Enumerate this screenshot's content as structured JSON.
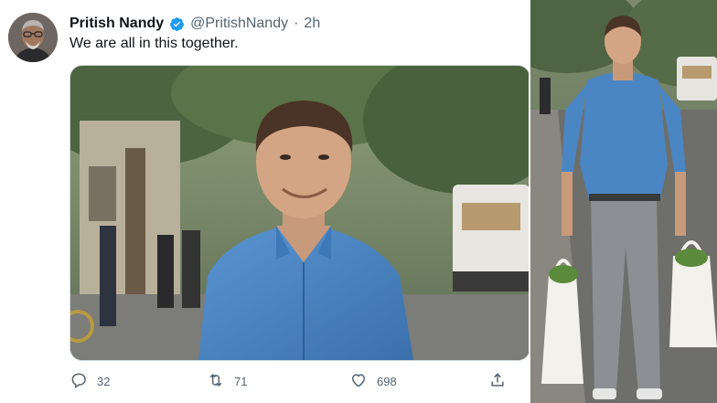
{
  "tweet": {
    "display_name": "Pritish Nandy",
    "handle": "@PritishNandy",
    "separator": "·",
    "time": "2h",
    "text": "We are all in this together.",
    "verified": true
  },
  "actions": {
    "reply_count": "32",
    "retweet_count": "71",
    "like_count": "698"
  },
  "colors": {
    "verified_blue": "#1d9bf0",
    "muted_text": "#536471",
    "shirt_blue": "#4a86c4"
  },
  "icons": [
    "verified-badge-icon",
    "reply-icon",
    "retweet-icon",
    "like-icon",
    "share-icon"
  ]
}
